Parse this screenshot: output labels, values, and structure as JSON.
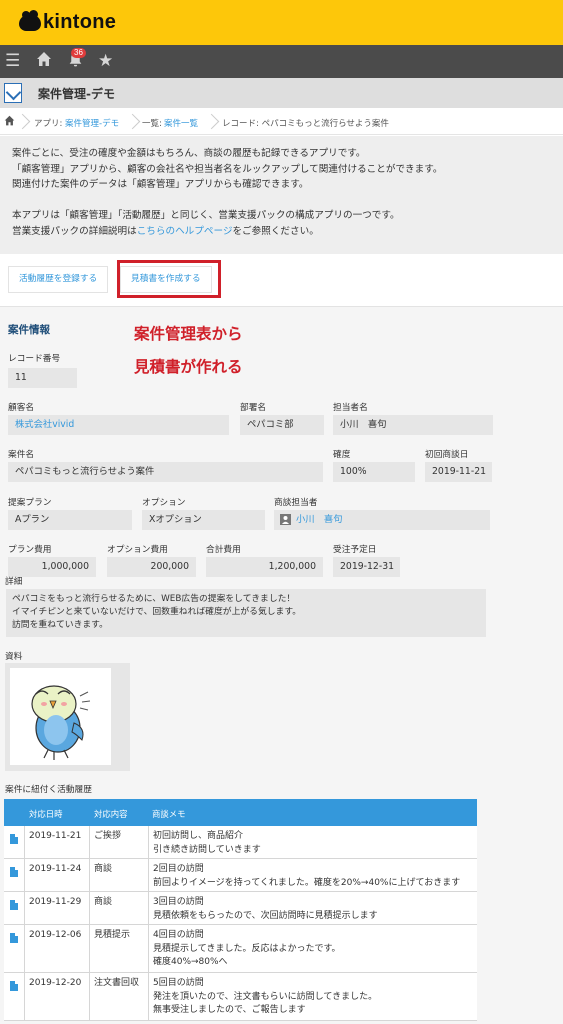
{
  "header": {
    "logo": "kintone",
    "notification_count": "36"
  },
  "app": {
    "title": "案件管理-デモ"
  },
  "breadcrumb": {
    "app_prefix": "アプリ: ",
    "app_name": "案件管理-デモ",
    "view_prefix": "一覧: ",
    "view_name": "案件一覧",
    "record": "レコード: ペパコミもっと流行らせよう案件"
  },
  "description": {
    "lines": [
      "案件ごとに、受注の確度や金額はもちろん、商談の履歴も記録できるアプリです。",
      "「顧客管理」アプリから、顧客の会社名や担当者名をルックアップして関連付けることができます。",
      "関連付けた案件のデータは「顧客管理」アプリからも確認できます。",
      "本アプリは「顧客管理」「活動履歴」と同じく、営業支援パックの構成アプリの一つです。"
    ],
    "last_prefix": "営業支援パックの詳細説明は",
    "last_link": "こちらのヘルプページ",
    "last_suffix": "をご参照ください。"
  },
  "actions": {
    "register_activity": "活動履歴を登録する",
    "create_quote": "見積書を作成する"
  },
  "annotation": {
    "line1": "案件管理表から",
    "line2": "見積書が作れる"
  },
  "form": {
    "section_title": "案件情報",
    "record_no_label": "レコード番号",
    "record_no": "11",
    "customer_label": "顧客名",
    "customer": "株式会社vivid",
    "department_label": "部署名",
    "department": "ペパコミ部",
    "contact_label": "担当者名",
    "contact": "小川　喜句",
    "deal_label": "案件名",
    "deal": "ペパコミもっと流行らせよう案件",
    "certainty_label": "確度",
    "certainty": "100%",
    "first_meeting_label": "初回商談日",
    "first_meeting": "2019-11-21",
    "plan_label": "提案プラン",
    "plan": "Aプラン",
    "option_label": "オプション",
    "option": "Xオプション",
    "rep_label": "商談担当者",
    "rep": "小川　喜句",
    "plan_cost_label": "プラン費用",
    "plan_cost": "1,000,000",
    "option_cost_label": "オプション費用",
    "option_cost": "200,000",
    "total_label": "合計費用",
    "total": "1,200,000",
    "order_date_label": "受注予定日",
    "order_date": "2019-12-31",
    "detail_label": "詳細",
    "detail_lines": [
      "ペパコミをもっと流行らせるために、WEB広告の提案をしてきました！",
      "イマイチピンと来ていないだけで、回数重ねれば確度が上がる気します。",
      "訪問を重ねていきます。"
    ],
    "attachment_label": "資料",
    "activity_label": "案件に紐付く活動履歴"
  },
  "table": {
    "headers": [
      "対応日時",
      "対応内容",
      "商談メモ"
    ],
    "rows": [
      {
        "date": "2019-11-21",
        "type": "ご挨拶",
        "memo1": "初回訪問し、商品紹介",
        "memo2": "引き続き訪問していきます",
        "memo3": ""
      },
      {
        "date": "2019-11-24",
        "type": "商談",
        "memo1": "2回目の訪問",
        "memo2": "前回よりイメージを持ってくれました。確度を20%→40%に上げておきます",
        "memo3": ""
      },
      {
        "date": "2019-11-29",
        "type": "商談",
        "memo1": "3回目の訪問",
        "memo2": "見積依頼をもらったので、次回訪問時に見積提示します",
        "memo3": ""
      },
      {
        "date": "2019-12-06",
        "type": "見積提示",
        "memo1": "4回目の訪問",
        "memo2": "見積提示してきました。反応はよかったです。",
        "memo3": "確度40%→80%へ"
      },
      {
        "date": "2019-12-20",
        "type": "注文書回収",
        "memo1": "5回目の訪問",
        "memo2": "発注を頂いたので、注文書もらいに訪問してきました。",
        "memo3": "無事受注しましたので、ご報告します"
      }
    ]
  }
}
